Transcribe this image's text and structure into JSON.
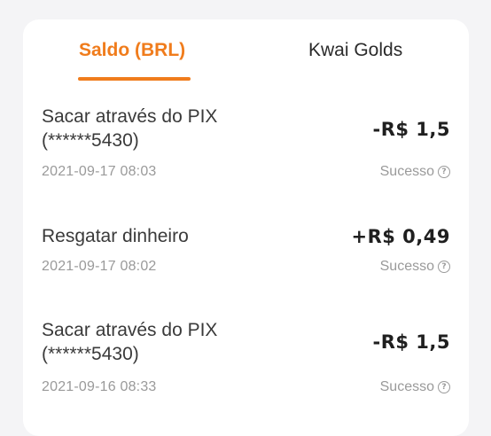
{
  "tabs": {
    "saldo_label": "Saldo (BRL)",
    "kwai_label": "Kwai Golds",
    "active": "Saldo (BRL)"
  },
  "colors": {
    "accent": "#f07c1c",
    "text_primary": "#2b2b2b",
    "text_secondary": "#9a9a9a",
    "background": "#f4f4f6"
  },
  "transactions": [
    {
      "title_line1": "Sacar através do PIX",
      "title_line2": "(******5430)",
      "amount": "-R$ 1,5",
      "date": "2021-09-17 08:03",
      "status": "Sucesso",
      "status_icon": "help-circle-icon"
    },
    {
      "title_line1": "Resgatar dinheiro",
      "title_line2": "",
      "amount": "+R$ 0,49",
      "date": "2021-09-17 08:02",
      "status": "Sucesso",
      "status_icon": "help-circle-icon"
    },
    {
      "title_line1": "Sacar através do PIX",
      "title_line2": "(******5430)",
      "amount": "-R$ 1,5",
      "date": "2021-09-16 08:33",
      "status": "Sucesso",
      "status_icon": "help-circle-icon"
    }
  ]
}
